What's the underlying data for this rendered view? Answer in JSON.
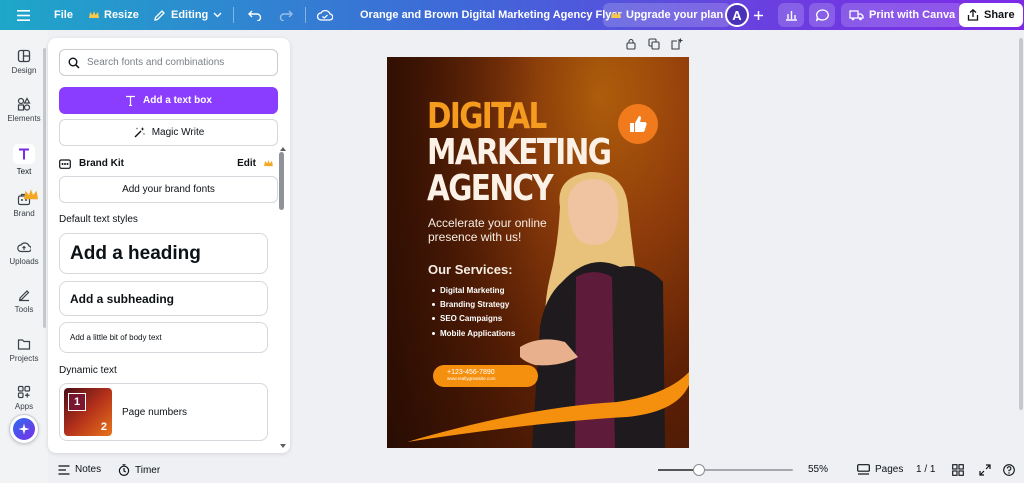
{
  "topbar": {
    "file_label": "File",
    "resize_label": "Resize",
    "editing_label": "Editing",
    "doc_title": "Orange and Brown Digital Marketing Agency Flyer",
    "upgrade_label": "Upgrade your plan",
    "avatar_initial": "A",
    "print_label": "Print with Canva",
    "share_label": "Share"
  },
  "rail": {
    "items": [
      {
        "label": "Design",
        "icon": "design-icon"
      },
      {
        "label": "Elements",
        "icon": "elements-icon"
      },
      {
        "label": "Text",
        "icon": "text-icon"
      },
      {
        "label": "Brand",
        "icon": "brand-icon"
      },
      {
        "label": "Uploads",
        "icon": "uploads-icon"
      },
      {
        "label": "Tools",
        "icon": "tools-icon"
      },
      {
        "label": "Projects",
        "icon": "projects-icon"
      },
      {
        "label": "Apps",
        "icon": "apps-icon"
      }
    ],
    "active": "Text"
  },
  "panel": {
    "search_placeholder": "Search fonts and combinations",
    "add_text_box": "Add a text box",
    "magic_write": "Magic Write",
    "brand_kit": "Brand Kit",
    "brand_kit_edit": "Edit",
    "add_brand_fonts": "Add your brand fonts",
    "default_styles_label": "Default text styles",
    "heading": "Add a heading",
    "subheading": "Add a subheading",
    "body": "Add a little bit of body text",
    "dynamic_label": "Dynamic text",
    "page_numbers": "Page numbers",
    "thumb_num_1": "1",
    "thumb_num_2": "2"
  },
  "flyer": {
    "title_1": "DIGITAL",
    "title_2": "MARKETING",
    "title_3": "AGENCY",
    "tagline": "Accelerate your online presence with us!",
    "services_heading": "Our Services:",
    "services": [
      "Digital Marketing",
      "Branding Strategy",
      "SEO Campaigns",
      "Mobile Applications"
    ],
    "phone": "+123-456-7890",
    "website": "www.reallygreatsite.com"
  },
  "bottombar": {
    "notes_label": "Notes",
    "timer_label": "Timer",
    "zoom": "55%",
    "zoom_value": 55,
    "pages_label": "Pages",
    "page_indicator": "1 / 1"
  },
  "colors": {
    "accent_purple": "#8b3dff",
    "flyer_orange": "#f59b1e"
  }
}
